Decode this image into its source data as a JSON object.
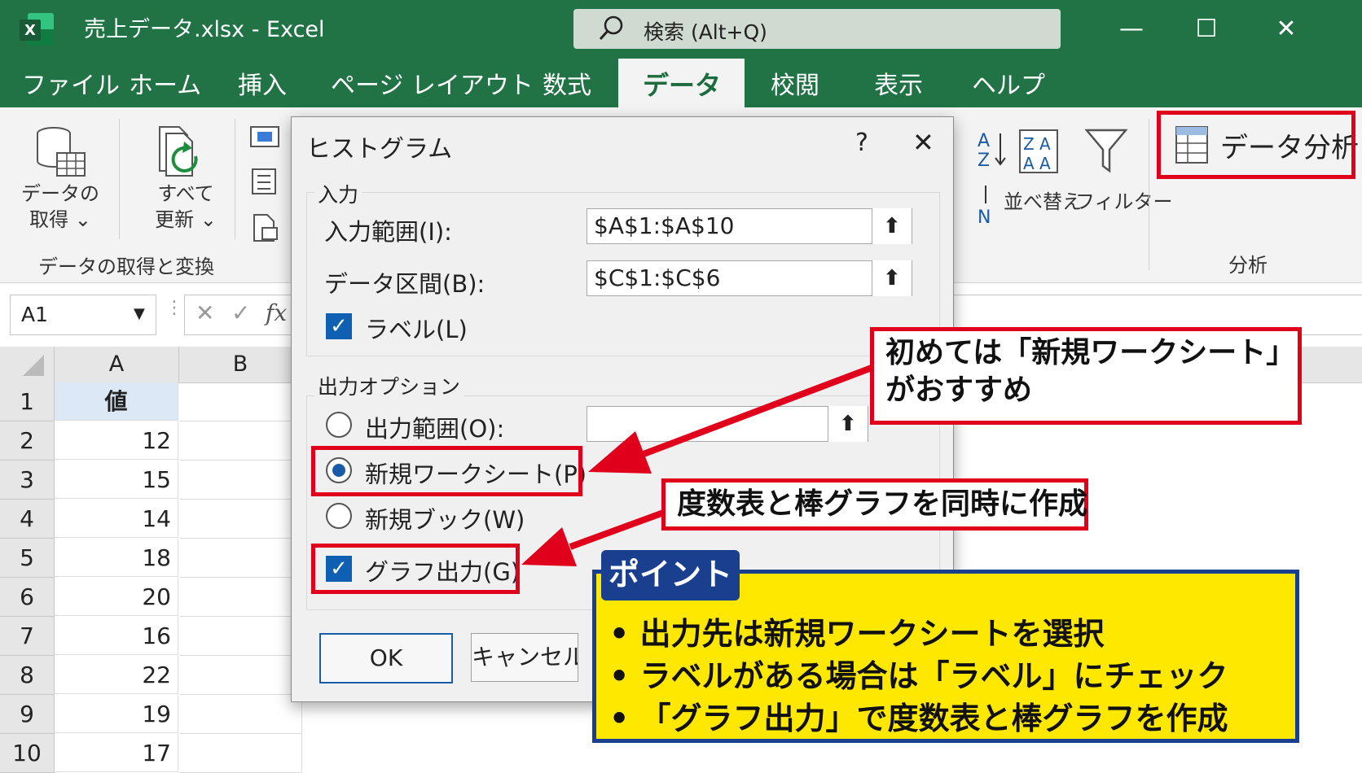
{
  "window": {
    "title": "売上データ.xlsx  -  Excel",
    "search_placeholder": "検索 (Alt+Q)",
    "logo_letter": "X",
    "minimize": "—",
    "maximize": "☐",
    "close": "✕"
  },
  "tabs": [
    "ファイル",
    "ホーム",
    "挿入",
    "ページ レイアウト",
    "数式",
    "データ",
    "校閲",
    "表示",
    "ヘルプ"
  ],
  "ribbon": {
    "get_data": "データの\n取得 ⌄",
    "get_data_line1": "データの",
    "get_data_line2": "取得 ⌄",
    "refresh_line1": "すべて",
    "refresh_line2": "更新 ⌄",
    "group_get_transform": "データの取得と変換",
    "sort": "並べ替え",
    "filter": "フィルター",
    "data_analysis": "データ分析",
    "group_analysis": "分析"
  },
  "formula_bar": {
    "name_box": "A1",
    "fx": "fx"
  },
  "sheet": {
    "columns": [
      "A",
      "B"
    ],
    "rows": [
      "1",
      "2",
      "3",
      "4",
      "5",
      "6",
      "7",
      "8",
      "9",
      "10"
    ],
    "values": [
      "値",
      "12",
      "15",
      "14",
      "18",
      "20",
      "16",
      "22",
      "19",
      "17"
    ]
  },
  "dialog": {
    "title": "ヒストグラム",
    "help": "?",
    "close": "✕",
    "input_group": "入力",
    "input_range_label": "入力範囲(I):",
    "input_range_value": "$A$1:$A$10",
    "bin_range_label": "データ区間(B):",
    "bin_range_value": "$C$1:$C$6",
    "labels_label": "ラベル(L)",
    "output_group": "出力オプション",
    "output_range_label": "出力範囲(O):",
    "new_sheet_label": "新規ワークシート(P)",
    "new_book_label": "新規ブック(W)",
    "chart_output_label": "グラフ出力(G)",
    "ok": "OK",
    "cancel": "キャンセル",
    "upload_glyph": "⬆"
  },
  "annotations": {
    "callout1_line1": "初めては「新規ワークシート」",
    "callout1_line2": "がおすすめ",
    "callout2": "度数表と棒グラフを同時に作成",
    "point_title": "ポイント",
    "bullets": [
      "• 出力先は新規ワークシートを選択",
      "• ラベルがある場合は「ラベル」にチェック",
      "• 「グラフ出力」で度数表と棒グラフを作成"
    ]
  },
  "colors": {
    "excel_green": "#217346",
    "annotation_red": "#e0001b",
    "point_yellow": "#ffe800",
    "point_navy": "#1a3f8f"
  }
}
